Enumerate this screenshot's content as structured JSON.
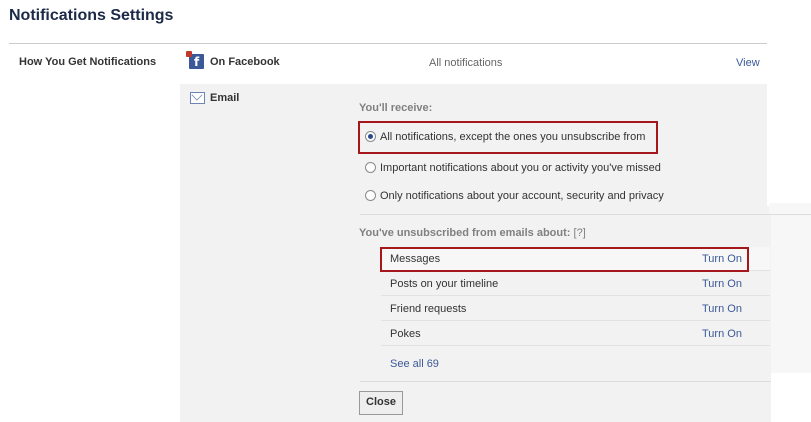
{
  "page": {
    "title": "Notifications Settings"
  },
  "section": {
    "label": "How You Get Notifications"
  },
  "on_facebook": {
    "icon": "facebook-icon",
    "label": "On Facebook",
    "status": "All notifications",
    "action": "View"
  },
  "email": {
    "icon": "mail-icon",
    "label": "Email",
    "receive_heading": "You'll receive:",
    "options": [
      {
        "label": "All notifications, except the ones you unsubscribe from",
        "selected": true
      },
      {
        "label": "Important notifications about you or activity you've missed",
        "selected": false
      },
      {
        "label": "Only notifications about your account, security and privacy",
        "selected": false
      }
    ],
    "unsubscribed_heading": "You've unsubscribed from emails about:",
    "help_link": "[?]",
    "unsubscribed": [
      {
        "label": "Messages",
        "action": "Turn On"
      },
      {
        "label": "Posts on your timeline",
        "action": "Turn On"
      },
      {
        "label": "Friend requests",
        "action": "Turn On"
      },
      {
        "label": "Pokes",
        "action": "Turn On"
      }
    ],
    "see_all": "See all 69",
    "close_label": "Close"
  },
  "colors": {
    "highlight": "#a6171c",
    "link": "#3b5998",
    "title": "#1c2a47"
  }
}
